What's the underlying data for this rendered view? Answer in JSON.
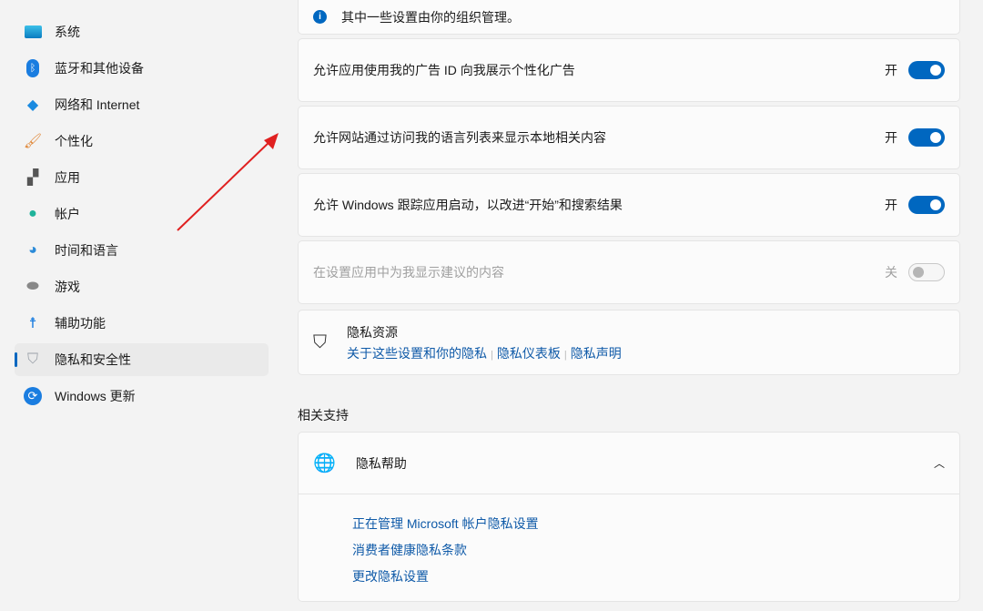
{
  "sidebar": {
    "items": [
      {
        "label": "系统",
        "icon": "system-icon"
      },
      {
        "label": "蓝牙和其他设备",
        "icon": "bluetooth-icon"
      },
      {
        "label": "网络和 Internet",
        "icon": "wifi-icon"
      },
      {
        "label": "个性化",
        "icon": "brush-icon"
      },
      {
        "label": "应用",
        "icon": "apps-icon"
      },
      {
        "label": "帐户",
        "icon": "account-icon"
      },
      {
        "label": "时间和语言",
        "icon": "globe-clock-icon"
      },
      {
        "label": "游戏",
        "icon": "gamepad-icon"
      },
      {
        "label": "辅助功能",
        "icon": "accessibility-icon"
      },
      {
        "label": "隐私和安全性",
        "icon": "shield-icon"
      },
      {
        "label": "Windows 更新",
        "icon": "update-icon"
      }
    ]
  },
  "notice": "其中一些设置由你的组织管理。",
  "settings": [
    {
      "label": "允许应用使用我的广告 ID 向我展示个性化广告",
      "state": "开"
    },
    {
      "label": "允许网站通过访问我的语言列表来显示本地相关内容",
      "state": "开"
    },
    {
      "label": "允许 Windows 跟踪应用启动，以改进“开始”和搜索结果",
      "state": "开"
    },
    {
      "label": "在设置应用中为我显示建议的内容",
      "state": "关"
    }
  ],
  "resources": {
    "title": "隐私资源",
    "links": [
      "关于这些设置和你的隐私",
      "隐私仪表板",
      "隐私声明"
    ]
  },
  "related": {
    "heading": "相关支持",
    "help_title": "隐私帮助",
    "links": [
      "正在管理 Microsoft 帐户隐私设置",
      "消费者健康隐私条款",
      "更改隐私设置"
    ]
  }
}
